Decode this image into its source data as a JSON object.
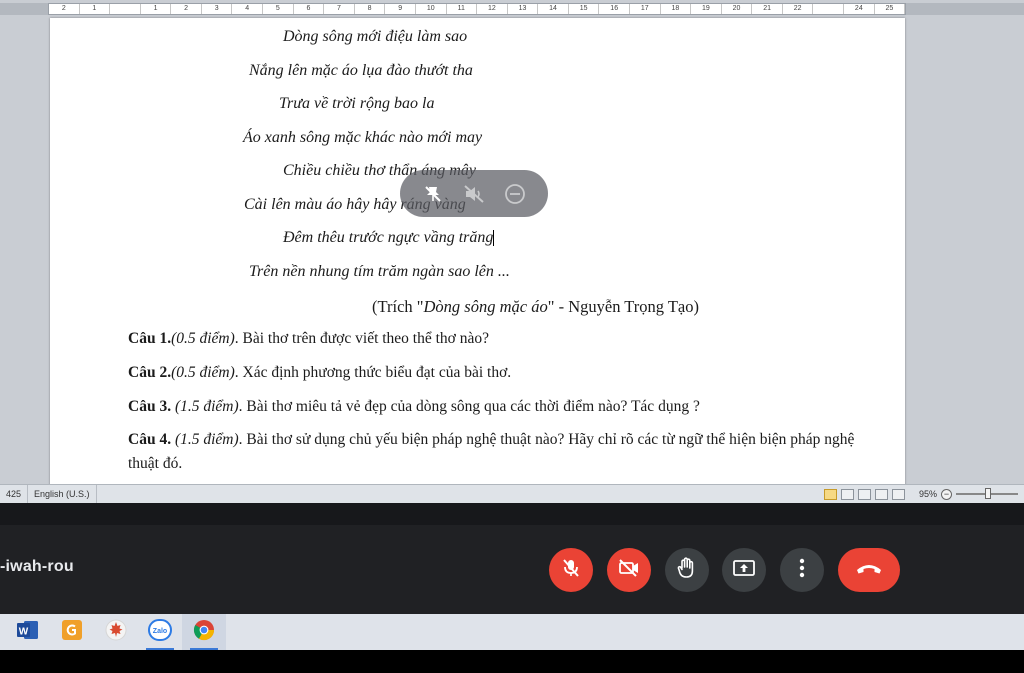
{
  "ruler": {
    "marks": [
      "2",
      "1",
      "",
      "1",
      "2",
      "3",
      "4",
      "5",
      "6",
      "7",
      "8",
      "9",
      "10",
      "11",
      "12",
      "13",
      "14",
      "15",
      "16",
      "17",
      "18",
      "19",
      "20",
      "21",
      "22",
      "",
      "24",
      "25"
    ]
  },
  "document": {
    "poem_lines": [
      "Dòng sông mới điệu làm sao",
      "Nắng lên mặc áo lụa đào thướt tha",
      "Trưa về trời rộng bao la",
      "Áo xanh sông mặc khác nào mới may",
      "Chiều chiều thơ thẩn áng mây",
      "Cài lên màu áo hây hây ráng vàng",
      "Đêm thêu trước ngực vầng trăng",
      "Trên nền nhung tím trăm ngàn sao lên ..."
    ],
    "citation": {
      "prefix": "(Trích \"",
      "title": "Dòng sông mặc áo",
      "suffix": "\" - Nguyễn Trọng Tạo)"
    },
    "questions": [
      {
        "label": "Câu 1.",
        "points": "(0.5 điểm)",
        "text": ". Bài thơ trên được viết theo thể thơ nào?"
      },
      {
        "label": "Câu 2.",
        "points": "(0.5 điểm)",
        "text": ". Xác định phương thức biểu đạt của bài thơ."
      },
      {
        "label": "Câu 3.",
        "points": " (1.5 điểm)",
        "text": ".  Bài thơ miêu tả vẻ đẹp của dòng sông qua các thời điểm nào? Tác dụng ?"
      },
      {
        "label": "Câu 4.",
        "points": " (1.5 điểm)",
        "text": ".  Bài thơ sử dụng chủ yếu biện pháp nghệ thuật nào? Hãy chỉ rõ các từ ngữ thể hiện biện pháp nghệ thuật đó."
      }
    ]
  },
  "statusbar": {
    "word_count": "425",
    "language": "English (U.S.)",
    "zoom": "95%",
    "zoom_level": 0.52
  },
  "meet": {
    "meeting_code": "-iwah-rou",
    "mic_state": "muted",
    "camera_state": "off"
  },
  "taskbar": {
    "apps": [
      "word-icon",
      "slides-icon",
      "maple-icon",
      "zalo-icon",
      "chrome-icon"
    ],
    "zalo_label": "Zalo"
  },
  "colors": {
    "meet_red": "#ea4335",
    "meet_gray": "#3c4043",
    "meet_bg": "#202124",
    "taskbar_bg": "#dfe3ea"
  }
}
